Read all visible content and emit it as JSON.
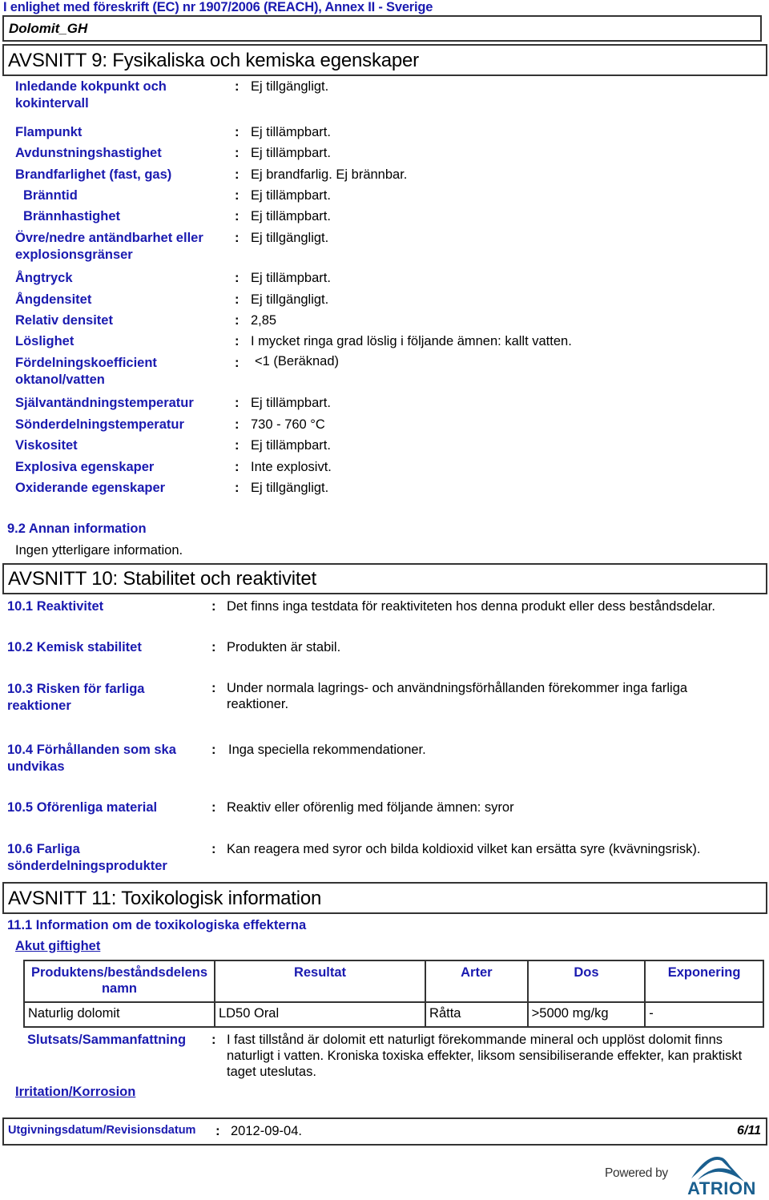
{
  "document": {
    "regulation_header": "I enlighet med föreskrift (EC) nr 1907/2006 (REACH), Annex II - Sverige",
    "product_name": "Dolomit_GH"
  },
  "colors": {
    "label_blue": "#1a1ab0",
    "border": "#333333",
    "logo_blue": "#1a5f8f"
  },
  "section9": {
    "title": "AVSNITT 9: Fysikaliska och kemiska egenskaper",
    "properties": [
      {
        "label": "Inledande kokpunkt och kokintervall",
        "value": "Ej tillgängligt."
      },
      {
        "label": "Flampunkt",
        "value": "Ej tillämpbart."
      },
      {
        "label": "Avdunstningshastighet",
        "value": "Ej tillämpbart."
      },
      {
        "label": "Brandfarlighet (fast, gas)",
        "value": "Ej brandfarlig. Ej brännbar."
      },
      {
        "label": "Bränntid",
        "value": "Ej tillämpbart."
      },
      {
        "label": "Brännhastighet",
        "value": "Ej tillämpbart."
      },
      {
        "label": "Övre/nedre antändbarhet eller explosionsgränser",
        "value": "Ej tillgängligt."
      },
      {
        "label": "Ångtryck",
        "value": "Ej tillämpbart."
      },
      {
        "label": "Ångdensitet",
        "value": "Ej tillgängligt."
      },
      {
        "label": "Relativ densitet",
        "value": "2,85"
      },
      {
        "label": "Löslighet",
        "value": "I mycket ringa grad löslig i följande ämnen: kallt vatten."
      },
      {
        "label": "Fördelningskoefficient oktanol/vatten",
        "value": "<1 (Beräknad)"
      },
      {
        "label": "Självantändningstemperatur",
        "value": "Ej tillämpbart."
      },
      {
        "label": "Sönderdelningstemperatur",
        "value": "730 - 760 °C"
      },
      {
        "label": "Viskositet",
        "value": "Ej tillämpbart."
      },
      {
        "label": "Explosiva egenskaper",
        "value": "Inte explosivt."
      },
      {
        "label": "Oxiderande egenskaper",
        "value": "Ej tillgängligt."
      }
    ],
    "other_info": {
      "heading": "9.2 Annan information",
      "text": "Ingen ytterligare information."
    }
  },
  "section10": {
    "title": "AVSNITT 10: Stabilitet och reaktivitet",
    "items": [
      {
        "label": "10.1 Reaktivitet",
        "value": "Det finns inga testdata för reaktiviteten hos denna produkt eller dess beståndsdelar."
      },
      {
        "label": "10.2 Kemisk stabilitet",
        "value": "Produkten är stabil."
      },
      {
        "label": "10.3 Risken för farliga reaktioner",
        "value": "Under normala lagrings- och användningsförhållanden förekommer inga farliga reaktioner."
      },
      {
        "label": "10.4 Förhållanden som ska undvikas",
        "value": "Inga speciella rekommendationer."
      },
      {
        "label": "10.5 Oförenliga material",
        "value": "Reaktiv eller oförenlig med följande ämnen: syror"
      },
      {
        "label": "10.6 Farliga sönderdelningsprodukter",
        "value": "Kan reagera med syror och bilda koldioxid vilket kan ersätta syre (kvävningsrisk)."
      }
    ]
  },
  "section11": {
    "title": "AVSNITT 11: Toxikologisk information",
    "subheading": "11.1 Information om de toxikologiska effekterna",
    "acute_toxicity": {
      "heading": "Akut giftighet",
      "table": {
        "headers": [
          "Produktens/beståndsdelens namn",
          "Resultat",
          "Arter",
          "Dos",
          "Exponering"
        ],
        "rows": [
          [
            "Naturlig dolomit",
            "LD50 Oral",
            "Råtta",
            ">5000 mg/kg",
            "-"
          ]
        ]
      },
      "conclusion_label": "Slutsats/Sammanfattning",
      "conclusion_text": "I fast tillstånd är dolomit ett naturligt förekommande mineral och upplöst dolomit finns naturligt i vatten. Kroniska toxiska effekter, liksom sensibiliserande effekter, kan praktiskt taget uteslutas."
    },
    "irritation": {
      "heading": "Irritation/Korrosion"
    }
  },
  "footer": {
    "date_label": "Utgivningsdatum/Revisionsdatum",
    "date_value": "2012-09-04.",
    "page": "6/11",
    "powered_by": "Powered by",
    "logo_text": "ATRION"
  },
  "common": {
    "colon": ":"
  }
}
